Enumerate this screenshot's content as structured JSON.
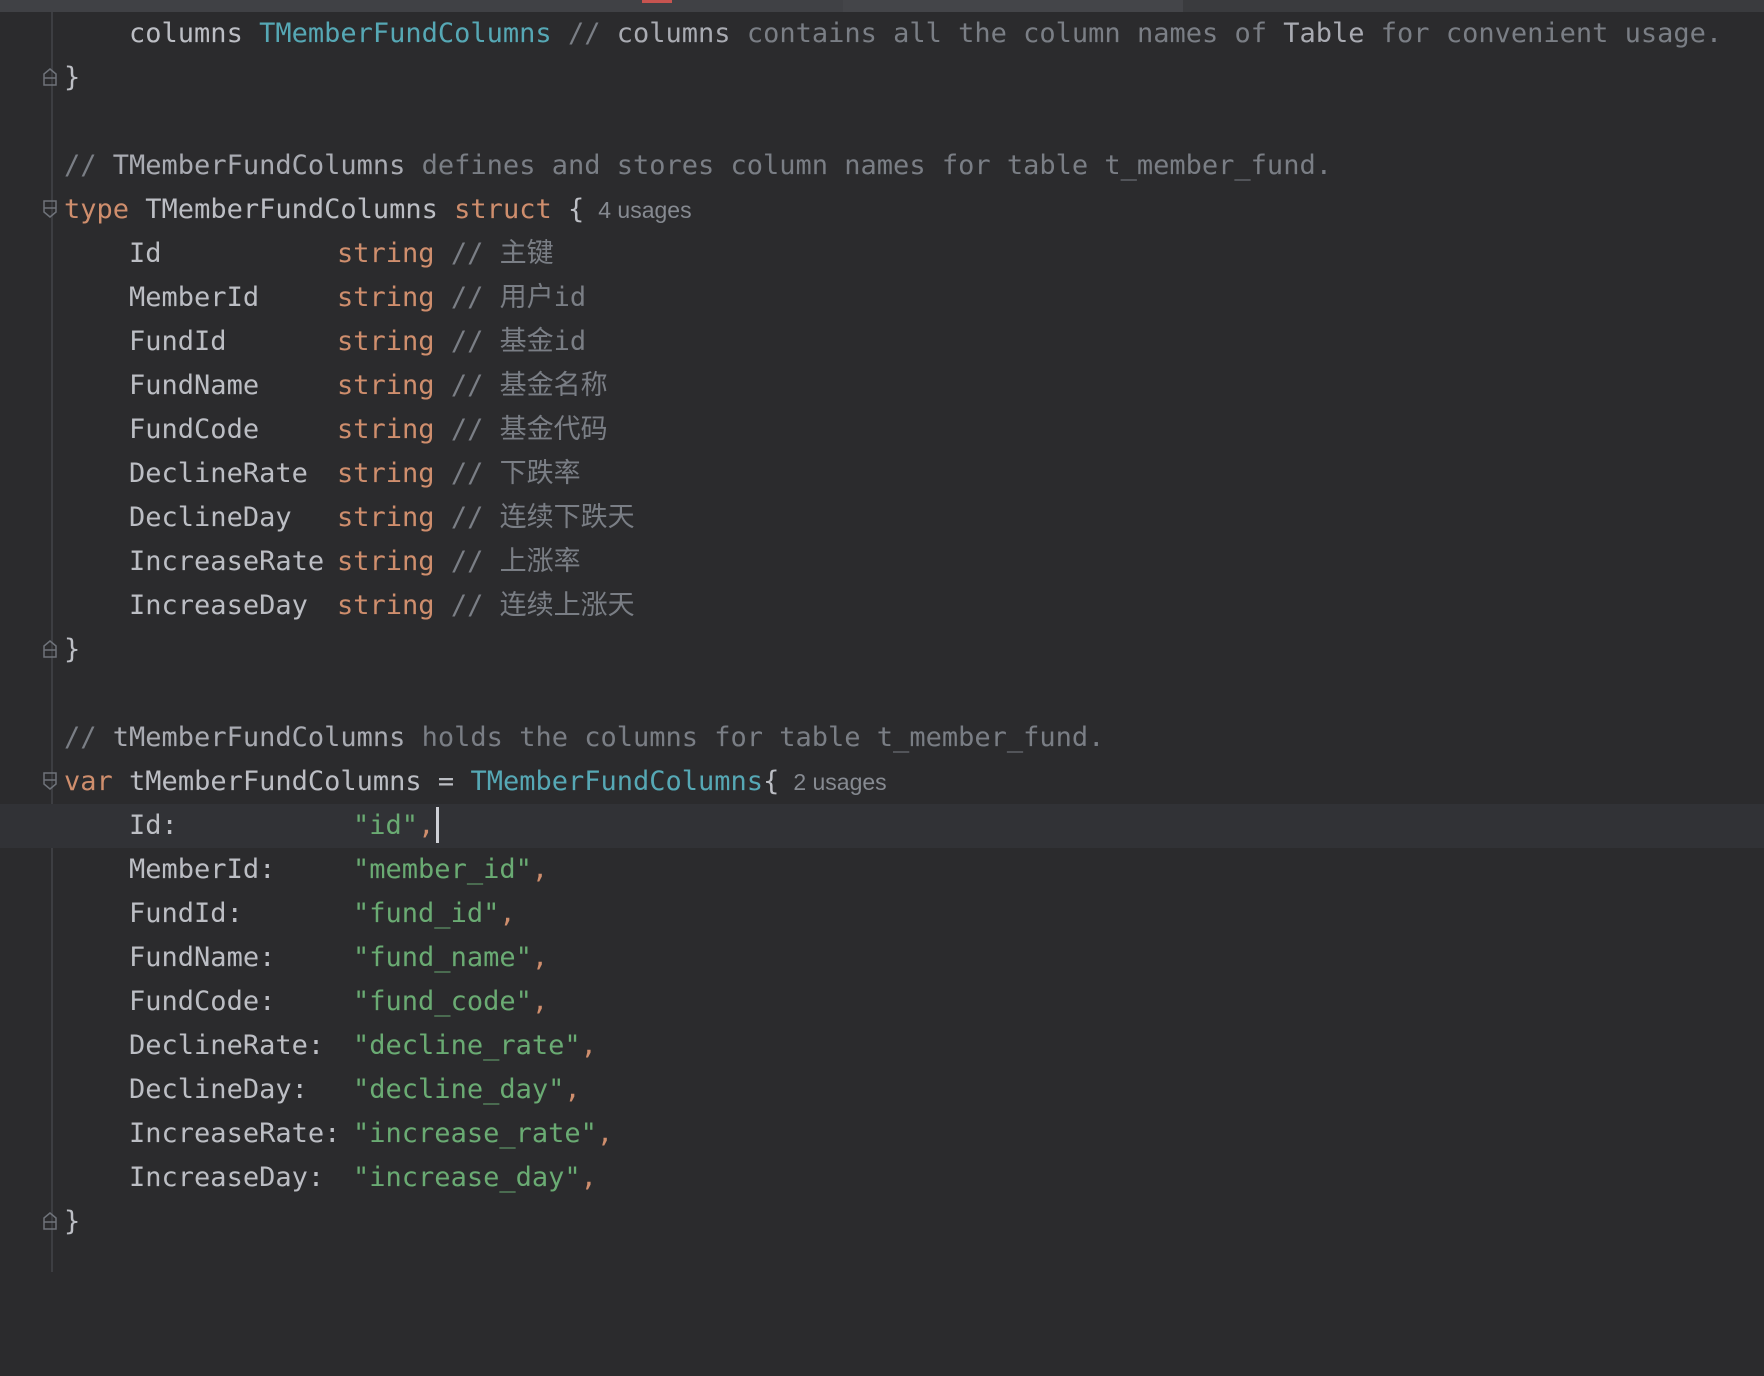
{
  "colors": {
    "background": "#2b2b2d",
    "keyword": "#cf8e6d",
    "type_name": "#56a8b5",
    "identifier": "#bcbec4",
    "comment": "#7a7e85",
    "string": "#6aab73",
    "inlay_hint": "#868a91"
  },
  "code": {
    "line1": {
      "field": "columns",
      "type": "TMemberFundColumns",
      "comment_slash": "//",
      "comment_word1": "columns",
      "comment_mid": "contains all the column names of",
      "comment_word2": "Table",
      "comment_end": "for convenient usage."
    },
    "close_brace": "}",
    "struct_comment": {
      "slash": "//",
      "name": "TMemberFundColumns",
      "text": "defines and stores column names for table t_member_fund."
    },
    "struct_decl": {
      "keyword": "type",
      "name": "TMemberFundColumns",
      "keyword2": "struct",
      "open_brace": "{",
      "usages": "4 usages"
    },
    "struct_fields": [
      {
        "name": "Id",
        "type": "string",
        "comment": "// 主键"
      },
      {
        "name": "MemberId",
        "type": "string",
        "comment": "// 用户id"
      },
      {
        "name": "FundId",
        "type": "string",
        "comment": "// 基金id"
      },
      {
        "name": "FundName",
        "type": "string",
        "comment": "// 基金名称"
      },
      {
        "name": "FundCode",
        "type": "string",
        "comment": "// 基金代码"
      },
      {
        "name": "DeclineRate",
        "type": "string",
        "comment": "// 下跌率"
      },
      {
        "name": "DeclineDay",
        "type": "string",
        "comment": "// 连续下跌天"
      },
      {
        "name": "IncreaseRate",
        "type": "string",
        "comment": "// 上涨率"
      },
      {
        "name": "IncreaseDay",
        "type": "string",
        "comment": "// 连续上涨天"
      }
    ],
    "var_comment": {
      "slash": "//",
      "name": "tMemberFundColumns",
      "text": "holds the columns for table t_member_fund."
    },
    "var_decl": {
      "keyword": "var",
      "name": "tMemberFundColumns",
      "equals": "=",
      "type": "TMemberFundColumns",
      "open_brace": "{",
      "usages": "2 usages"
    },
    "var_fields": [
      {
        "key": "Id:",
        "value": "\"id\"",
        "comma": ","
      },
      {
        "key": "MemberId:",
        "value": "\"member_id\"",
        "comma": ","
      },
      {
        "key": "FundId:",
        "value": "\"fund_id\"",
        "comma": ","
      },
      {
        "key": "FundName:",
        "value": "\"fund_name\"",
        "comma": ","
      },
      {
        "key": "FundCode:",
        "value": "\"fund_code\"",
        "comma": ","
      },
      {
        "key": "DeclineRate:",
        "value": "\"decline_rate\"",
        "comma": ","
      },
      {
        "key": "DeclineDay:",
        "value": "\"decline_day\"",
        "comma": ","
      },
      {
        "key": "IncreaseRate:",
        "value": "\"increase_rate\"",
        "comma": ","
      },
      {
        "key": "IncreaseDay:",
        "value": "\"increase_day\"",
        "comma": ","
      }
    ]
  }
}
